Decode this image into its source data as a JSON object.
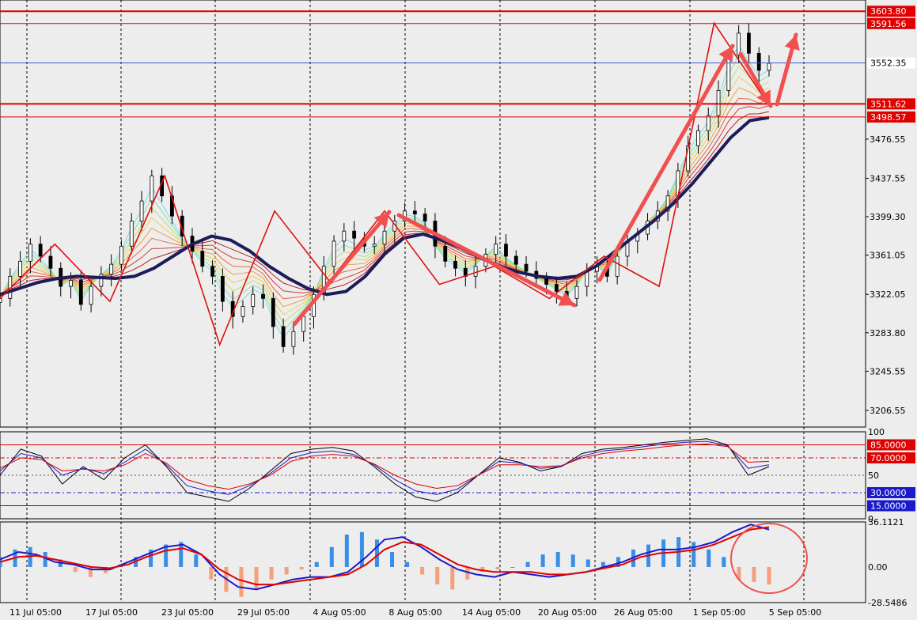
{
  "chart_data": [
    {
      "type": "line",
      "name": "price-panel",
      "title": "",
      "ylim": [
        3190,
        3615
      ],
      "y_ticks": [
        "3476.55",
        "3437.55",
        "3399.30",
        "3361.05",
        "3322.05",
        "3283.80",
        "3245.55",
        "3206.55"
      ],
      "y_tick_values": [
        3476.55,
        3437.55,
        3399.3,
        3361.05,
        3322.05,
        3283.8,
        3245.55,
        3206.55
      ],
      "current_price": {
        "label": "3552.35",
        "value": 3552.35
      },
      "horizontal_levels": [
        {
          "label": "3603.80",
          "value": 3603.8,
          "color": "#e00000"
        },
        {
          "label": "3591.56",
          "value": 3591.56,
          "color": "#e00000"
        },
        {
          "label": "3511.62",
          "value": 3511.62,
          "color": "#e00000"
        },
        {
          "label": "3498.57",
          "value": 3498.57,
          "color": "#e00000"
        }
      ],
      "series": [
        {
          "kind": "close-trace",
          "values": [
            3318,
            3340,
            3355,
            3372,
            3360,
            3348,
            3330,
            3336,
            3312,
            3330,
            3342,
            3352,
            3370,
            3395,
            3415,
            3440,
            3420,
            3400,
            3380,
            3365,
            3350,
            3340,
            3315,
            3300,
            3310,
            3322,
            3318,
            3290,
            3270,
            3285,
            3300,
            3322,
            3350,
            3375,
            3385,
            3378,
            3370,
            3372,
            3385,
            3395,
            3405,
            3402,
            3395,
            3370,
            3355,
            3348,
            3340,
            3350,
            3362,
            3372,
            3360,
            3352,
            3345,
            3338,
            3332,
            3325,
            3318,
            3330,
            3345,
            3350,
            3340,
            3360,
            3375,
            3382,
            3395,
            3405,
            3420,
            3445,
            3470,
            3485,
            3500,
            3525,
            3560,
            3582,
            3562,
            3545,
            3552
          ]
        },
        {
          "kind": "slow-ma",
          "values": [
            3322,
            3328,
            3334,
            3338,
            3340,
            3339,
            3338,
            3340,
            3348,
            3360,
            3372,
            3380,
            3376,
            3365,
            3350,
            3338,
            3328,
            3322,
            3325,
            3340,
            3362,
            3378,
            3382,
            3376,
            3368,
            3358,
            3350,
            3344,
            3340,
            3338,
            3340,
            3350,
            3365,
            3380,
            3395,
            3412,
            3432,
            3455,
            3478,
            3495,
            3498
          ]
        }
      ],
      "zigzag_points": [
        3318,
        3372,
        3315,
        3440,
        3272,
        3405,
        3335,
        3405,
        3332,
        3350,
        3318,
        3360,
        3330,
        3592,
        3510
      ],
      "time_labels": [
        "11 Jul 05:00",
        "17 Jul 05:00",
        "23 Jul 05:00",
        "29 Jul 05:00",
        "4 Aug 05:00",
        "8 Aug 05:00",
        "14 Aug 05:00",
        "20 Aug 05:00",
        "26 Aug 05:00",
        "1 Sep 05:00",
        "5 Sep 05:00"
      ]
    },
    {
      "type": "line",
      "name": "stochastic-panel",
      "ylim": [
        0,
        100
      ],
      "y_ticks": [
        "100",
        "50",
        "0"
      ],
      "y_tick_values": [
        100,
        50,
        0
      ],
      "levels": [
        {
          "label": "85.0000",
          "value": 85,
          "color": "#e00000"
        },
        {
          "label": "70.0000",
          "value": 70,
          "color": "#e00000"
        },
        {
          "label": "30.0000",
          "value": 30,
          "color": "#1a1acc"
        },
        {
          "label": "15.0000",
          "value": 15,
          "color": "#1a1acc"
        }
      ],
      "series": [
        {
          "color": "#000000",
          "values": [
            50,
            80,
            72,
            40,
            60,
            45,
            70,
            85,
            60,
            30,
            25,
            20,
            35,
            55,
            75,
            80,
            82,
            78,
            60,
            40,
            25,
            20,
            30,
            50,
            70,
            65,
            55,
            60,
            75,
            80,
            82,
            85,
            88,
            90,
            92,
            85,
            50,
            60
          ]
        },
        {
          "color": "#1a1acc",
          "values": [
            55,
            75,
            70,
            50,
            58,
            52,
            65,
            80,
            62,
            38,
            32,
            28,
            38,
            52,
            70,
            76,
            78,
            74,
            62,
            45,
            32,
            28,
            34,
            50,
            66,
            64,
            58,
            60,
            72,
            78,
            80,
            83,
            86,
            88,
            89,
            84,
            58,
            62
          ]
        },
        {
          "color": "#e00000",
          "values": [
            58,
            70,
            68,
            55,
            57,
            55,
            62,
            75,
            64,
            45,
            38,
            34,
            40,
            50,
            66,
            72,
            74,
            72,
            63,
            50,
            40,
            35,
            38,
            50,
            62,
            62,
            60,
            61,
            70,
            75,
            78,
            80,
            83,
            85,
            86,
            83,
            65,
            66
          ]
        }
      ]
    },
    {
      "type": "bar",
      "name": "macd-panel",
      "ylim": [
        -28.5486,
        36.1121
      ],
      "y_ticks": [
        "36.1121",
        "0.00",
        "-28.5486"
      ],
      "y_tick_values": [
        36.1121,
        0,
        -28.5486
      ],
      "histogram": [
        8,
        14,
        16,
        12,
        6,
        -4,
        -8,
        -5,
        2,
        8,
        14,
        18,
        20,
        10,
        -10,
        -20,
        -24,
        -18,
        -10,
        -6,
        -2,
        4,
        16,
        26,
        28,
        22,
        12,
        4,
        -6,
        -14,
        -18,
        -10,
        -4,
        -2,
        0,
        4,
        10,
        12,
        10,
        6,
        4,
        8,
        14,
        18,
        22,
        24,
        20,
        14,
        8,
        -10,
        -12,
        -14
      ],
      "series": [
        {
          "name": "",
          "color": "#1a1acc",
          "values": [
            6,
            12,
            10,
            4,
            2,
            -2,
            -2,
            4,
            10,
            16,
            18,
            10,
            -6,
            -16,
            -18,
            -14,
            -10,
            -8,
            -8,
            -4,
            8,
            22,
            24,
            16,
            6,
            -2,
            -6,
            -8,
            -4,
            -6,
            -8,
            -6,
            -4,
            0,
            4,
            10,
            14,
            14,
            16,
            20,
            28,
            34,
            30
          ]
        },
        {
          "name": "",
          "color": "#e00000",
          "values": [
            4,
            8,
            9,
            6,
            3,
            0,
            -1,
            2,
            8,
            13,
            15,
            10,
            -2,
            -10,
            -14,
            -14,
            -12,
            -10,
            -8,
            -6,
            2,
            14,
            20,
            18,
            10,
            2,
            -2,
            -4,
            -4,
            -4,
            -6,
            -6,
            -4,
            -1,
            2,
            8,
            11,
            12,
            14,
            18,
            24,
            30,
            32
          ]
        }
      ]
    }
  ]
}
